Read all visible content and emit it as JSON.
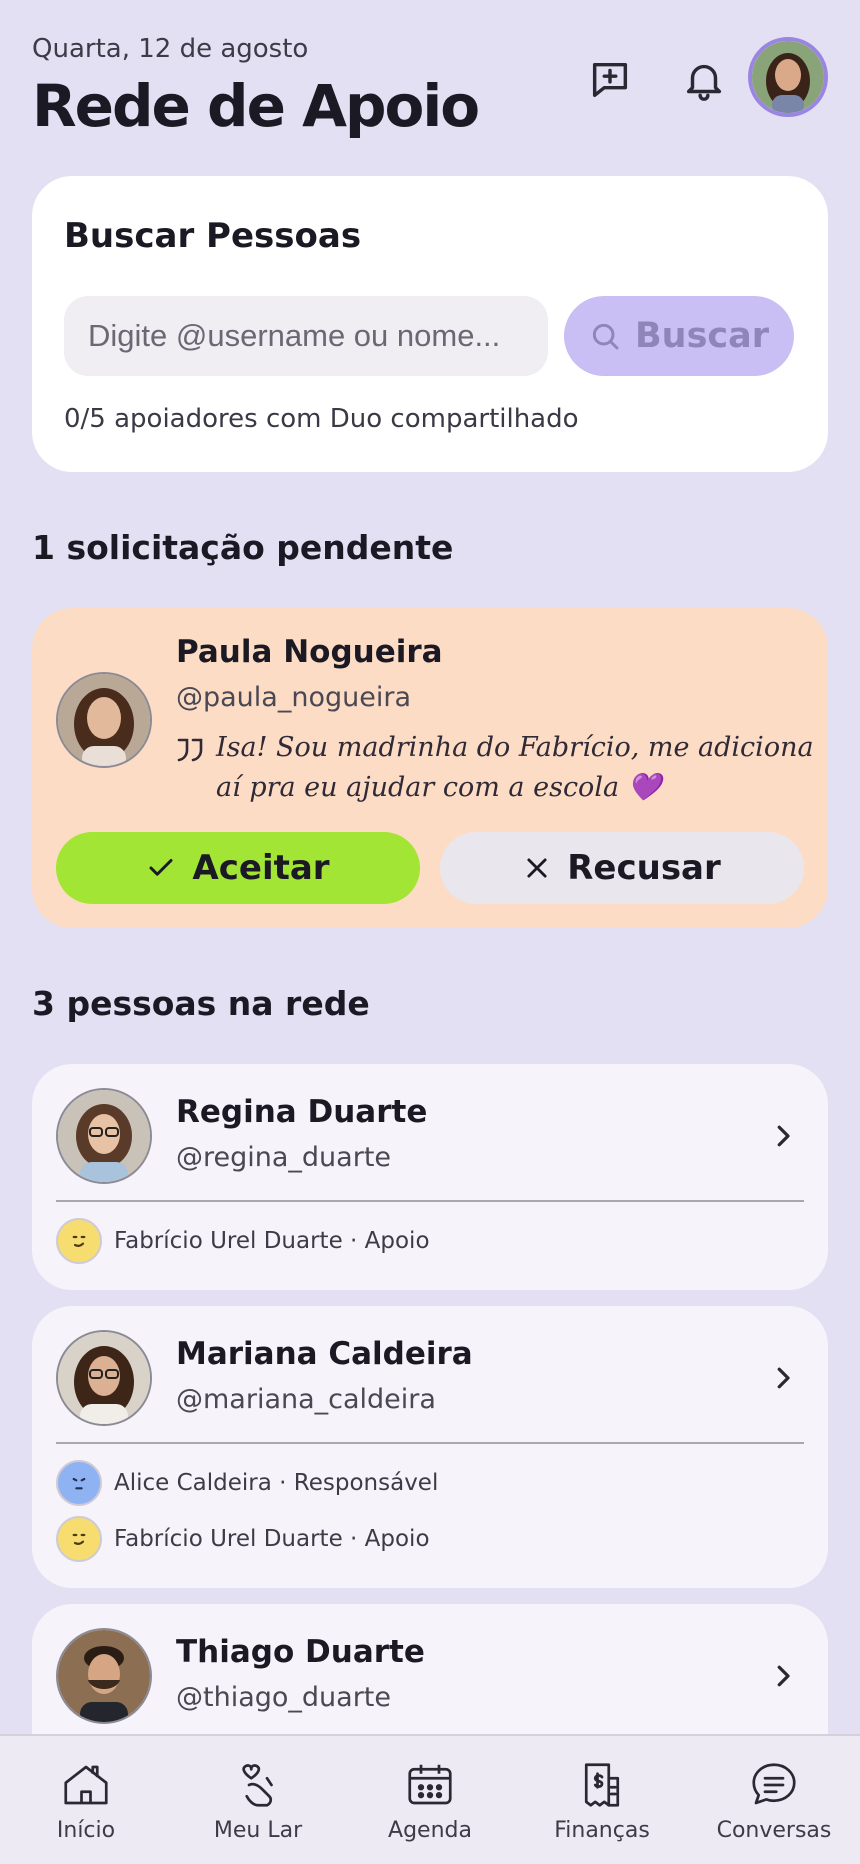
{
  "header": {
    "date": "Quarta, 12 de agosto",
    "title": "Rede de Apoio"
  },
  "search": {
    "title": "Buscar Pessoas",
    "placeholder": "Digite @username ou nome...",
    "button_label": "Buscar",
    "note": "0/5 apoiadores com Duo compartilhado"
  },
  "pending": {
    "section_title": "1 solicitação pendente",
    "request": {
      "name": "Paula Nogueira",
      "username": "@paula_nogueira",
      "message": "Isa! Sou madrinha do Fabrício, me adiciona aí pra eu ajudar com a escola 💜",
      "accept_label": "Aceitar",
      "reject_label": "Recusar"
    }
  },
  "network": {
    "section_title": "3 pessoas na rede",
    "people": [
      {
        "name": "Regina Duarte",
        "username": "@regina_duarte",
        "relations": [
          {
            "text": "Fabrício Urel Duarte · Apoio",
            "color": "#f7dc6f"
          }
        ]
      },
      {
        "name": "Mariana Caldeira",
        "username": "@mariana_caldeira",
        "relations": [
          {
            "text": "Alice Caldeira · Responsável",
            "color": "#8fb3f2"
          },
          {
            "text": "Fabrício Urel Duarte · Apoio",
            "color": "#f7dc6f"
          }
        ]
      },
      {
        "name": "Thiago Duarte",
        "username": "@thiago_duarte"
      }
    ]
  },
  "tabs": [
    {
      "label": "Início",
      "icon": "home-icon"
    },
    {
      "label": "Meu Lar",
      "icon": "heart-hand-icon"
    },
    {
      "label": "Agenda",
      "icon": "calendar-icon"
    },
    {
      "label": "Finanças",
      "icon": "receipt-icon"
    },
    {
      "label": "Conversas",
      "icon": "chat-icon"
    }
  ],
  "colors": {
    "background": "#e3e0f3",
    "accept": "#a2e535",
    "request_card": "#fddcc5",
    "search_button": "#c9bff4"
  }
}
